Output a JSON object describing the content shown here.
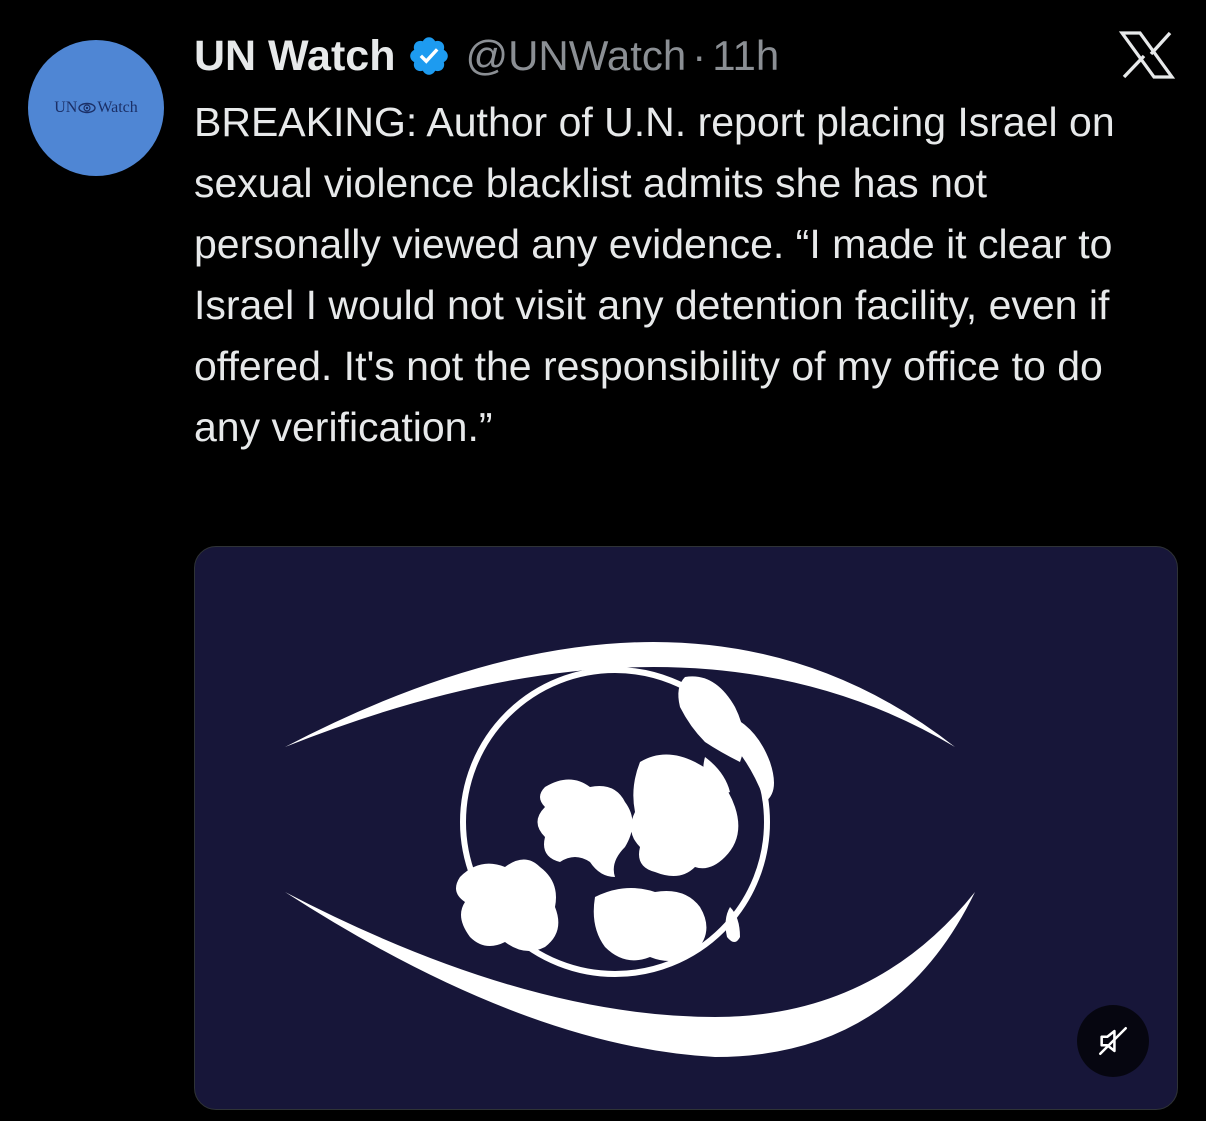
{
  "tweet": {
    "avatar": {
      "text_left": "UN",
      "text_right": "Watch",
      "color": "#4f86d4"
    },
    "author": {
      "display_name": "UN Watch",
      "verified": true,
      "handle": "@UNWatch",
      "separator": "·",
      "time": "11h"
    },
    "platform_icon": "x-logo-icon",
    "text": "BREAKING: Author of U.N. report placing Israel on sexual violence blacklist admits she has not personally viewed any evidence. “I made it clear to Israel I would not visit any detention facility, even if offered. It's not the responsibility of my office to do any verification.”",
    "media": {
      "type": "video",
      "background": "#171639",
      "logo_icon": "eye-globe-logo-icon",
      "muted": true,
      "mute_icon": "speaker-muted-icon"
    }
  }
}
